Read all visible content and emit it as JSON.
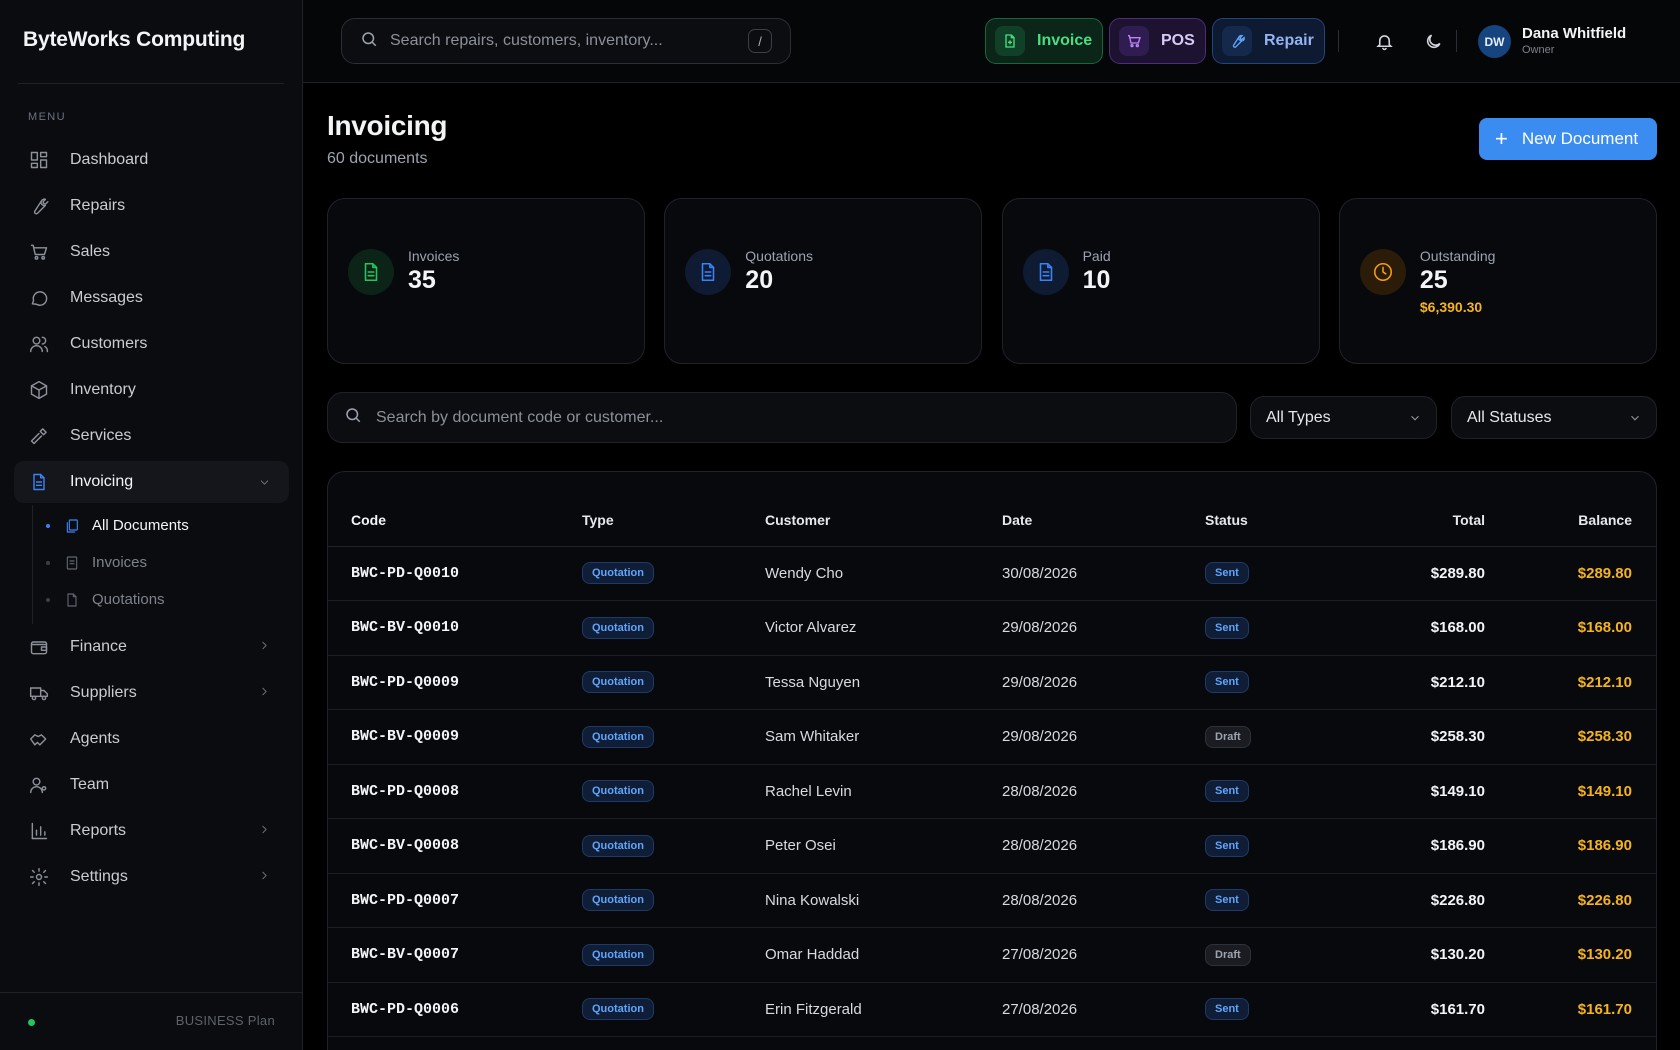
{
  "brand": "ByteWorks Computing",
  "menu_heading": "MENU",
  "nav": [
    {
      "label": "Dashboard",
      "icon": "dashboard-icon"
    },
    {
      "label": "Repairs",
      "icon": "wrench-icon"
    },
    {
      "label": "Sales",
      "icon": "cart-icon"
    },
    {
      "label": "Messages",
      "icon": "message-icon"
    },
    {
      "label": "Customers",
      "icon": "users-icon"
    },
    {
      "label": "Inventory",
      "icon": "box-icon"
    },
    {
      "label": "Services",
      "icon": "hammer-icon"
    },
    {
      "label": "Invoicing",
      "icon": "document-icon",
      "expanded": true
    },
    {
      "label": "Finance",
      "icon": "wallet-icon"
    },
    {
      "label": "Suppliers",
      "icon": "truck-icon"
    },
    {
      "label": "Agents",
      "icon": "handshake-icon"
    },
    {
      "label": "Team",
      "icon": "team-icon"
    },
    {
      "label": "Reports",
      "icon": "chart-icon"
    },
    {
      "label": "Settings",
      "icon": "gear-icon"
    }
  ],
  "subnav": [
    {
      "label": "All Documents",
      "icon": "documents-icon",
      "active": true
    },
    {
      "label": "Invoices",
      "icon": "invoice-icon"
    },
    {
      "label": "Quotations",
      "icon": "quotation-icon"
    }
  ],
  "footer": {
    "plan": "BUSINESS Plan"
  },
  "topbar": {
    "search_placeholder": "Search repairs, customers, inventory...",
    "search_shortcut": "/",
    "quick_invoice": "Invoice",
    "quick_pos": "POS",
    "quick_repair": "Repair",
    "user": {
      "initials": "DW",
      "name": "Dana Whitfield",
      "role": "Owner"
    }
  },
  "page": {
    "title": "Invoicing",
    "subtitle": "60 documents",
    "new_button": "New Document"
  },
  "stats": [
    {
      "label": "Invoices",
      "value": "35",
      "color": "#22c55e"
    },
    {
      "label": "Quotations",
      "value": "20",
      "color": "#3b82f6"
    },
    {
      "label": "Paid",
      "value": "10",
      "color": "#3b82f6"
    },
    {
      "label": "Outstanding",
      "value": "25",
      "extra": "$6,390.30",
      "color": "#f59e0b"
    }
  ],
  "filters": {
    "search_placeholder": "Search by document code or customer...",
    "type": "All Types",
    "status": "All Statuses"
  },
  "table": {
    "headers": [
      "Code",
      "Type",
      "Customer",
      "Date",
      "Status",
      "Total",
      "Balance"
    ],
    "rows": [
      {
        "code": "BWC-PD-Q0010",
        "type": "Quotation",
        "customer": "Wendy Cho",
        "date": "30/08/2026",
        "status": "Sent",
        "total": "$289.80",
        "balance": "$289.80"
      },
      {
        "code": "BWC-BV-Q0010",
        "type": "Quotation",
        "customer": "Victor Alvarez",
        "date": "29/08/2026",
        "status": "Sent",
        "total": "$168.00",
        "balance": "$168.00"
      },
      {
        "code": "BWC-PD-Q0009",
        "type": "Quotation",
        "customer": "Tessa Nguyen",
        "date": "29/08/2026",
        "status": "Sent",
        "total": "$212.10",
        "balance": "$212.10"
      },
      {
        "code": "BWC-BV-Q0009",
        "type": "Quotation",
        "customer": "Sam Whitaker",
        "date": "29/08/2026",
        "status": "Draft",
        "total": "$258.30",
        "balance": "$258.30"
      },
      {
        "code": "BWC-PD-Q0008",
        "type": "Quotation",
        "customer": "Rachel Levin",
        "date": "28/08/2026",
        "status": "Sent",
        "total": "$149.10",
        "balance": "$149.10"
      },
      {
        "code": "BWC-BV-Q0008",
        "type": "Quotation",
        "customer": "Peter Osei",
        "date": "28/08/2026",
        "status": "Sent",
        "total": "$186.90",
        "balance": "$186.90"
      },
      {
        "code": "BWC-PD-Q0007",
        "type": "Quotation",
        "customer": "Nina Kowalski",
        "date": "28/08/2026",
        "status": "Sent",
        "total": "$226.80",
        "balance": "$226.80"
      },
      {
        "code": "BWC-BV-Q0007",
        "type": "Quotation",
        "customer": "Omar Haddad",
        "date": "27/08/2026",
        "status": "Draft",
        "total": "$130.20",
        "balance": "$130.20"
      },
      {
        "code": "BWC-PD-Q0006",
        "type": "Quotation",
        "customer": "Erin Fitzgerald",
        "date": "27/08/2026",
        "status": "Sent",
        "total": "$161.70",
        "balance": "$161.70"
      },
      {
        "code": "",
        "type": "",
        "customer": "",
        "date": "",
        "status": "",
        "total": "",
        "balance": ""
      }
    ]
  }
}
